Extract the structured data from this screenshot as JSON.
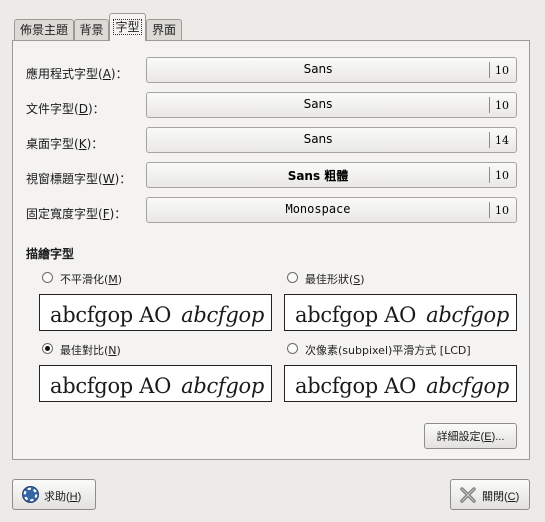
{
  "tabs": [
    {
      "label": "佈景主題"
    },
    {
      "label": "背景"
    },
    {
      "label": "字型"
    },
    {
      "label": "界面"
    }
  ],
  "fonts": {
    "application": {
      "label_pre": "應用程式字型(",
      "key": "A",
      "label_post": ")：",
      "font": "Sans",
      "size": "10"
    },
    "document": {
      "label_pre": "文件字型(",
      "key": "D",
      "label_post": ")：",
      "font": "Sans",
      "size": "10"
    },
    "desktop": {
      "label_pre": "桌面字型(",
      "key": "K",
      "label_post": ")：",
      "font": "Sans",
      "size": "14"
    },
    "window_title": {
      "label_pre": "視窗標題字型(",
      "key": "W",
      "label_post": ")：",
      "font": "Sans 粗體",
      "size": "10"
    },
    "fixed_width": {
      "label_pre": "固定寬度字型(",
      "key": "F",
      "label_post": ")：",
      "font": "Monospace",
      "size": "10"
    }
  },
  "rendering": {
    "title": "描繪字型",
    "preview_text": "abcfgop  AO",
    "preview_italic": "abcfgop",
    "options": [
      {
        "pre": "不平滑化(",
        "key": "M",
        "post": ")",
        "selected": false
      },
      {
        "pre": "最佳形狀(",
        "key": "S",
        "post": ")",
        "selected": false
      },
      {
        "pre": "最佳對比(",
        "key": "N",
        "post": ")",
        "selected": true
      },
      {
        "pre": "次像素(subpixel)平滑方式 [LCD]",
        "key": "",
        "post": "",
        "selected": false
      }
    ]
  },
  "details_button": {
    "pre": "詳細設定(",
    "key": "E",
    "post": ")..."
  },
  "help_button": {
    "pre": "求助(",
    "key": "H",
    "post": ")",
    "icon": "help-icon"
  },
  "close_button": {
    "pre": "關閉(",
    "key": "C",
    "post": ")",
    "icon": "close-icon"
  }
}
